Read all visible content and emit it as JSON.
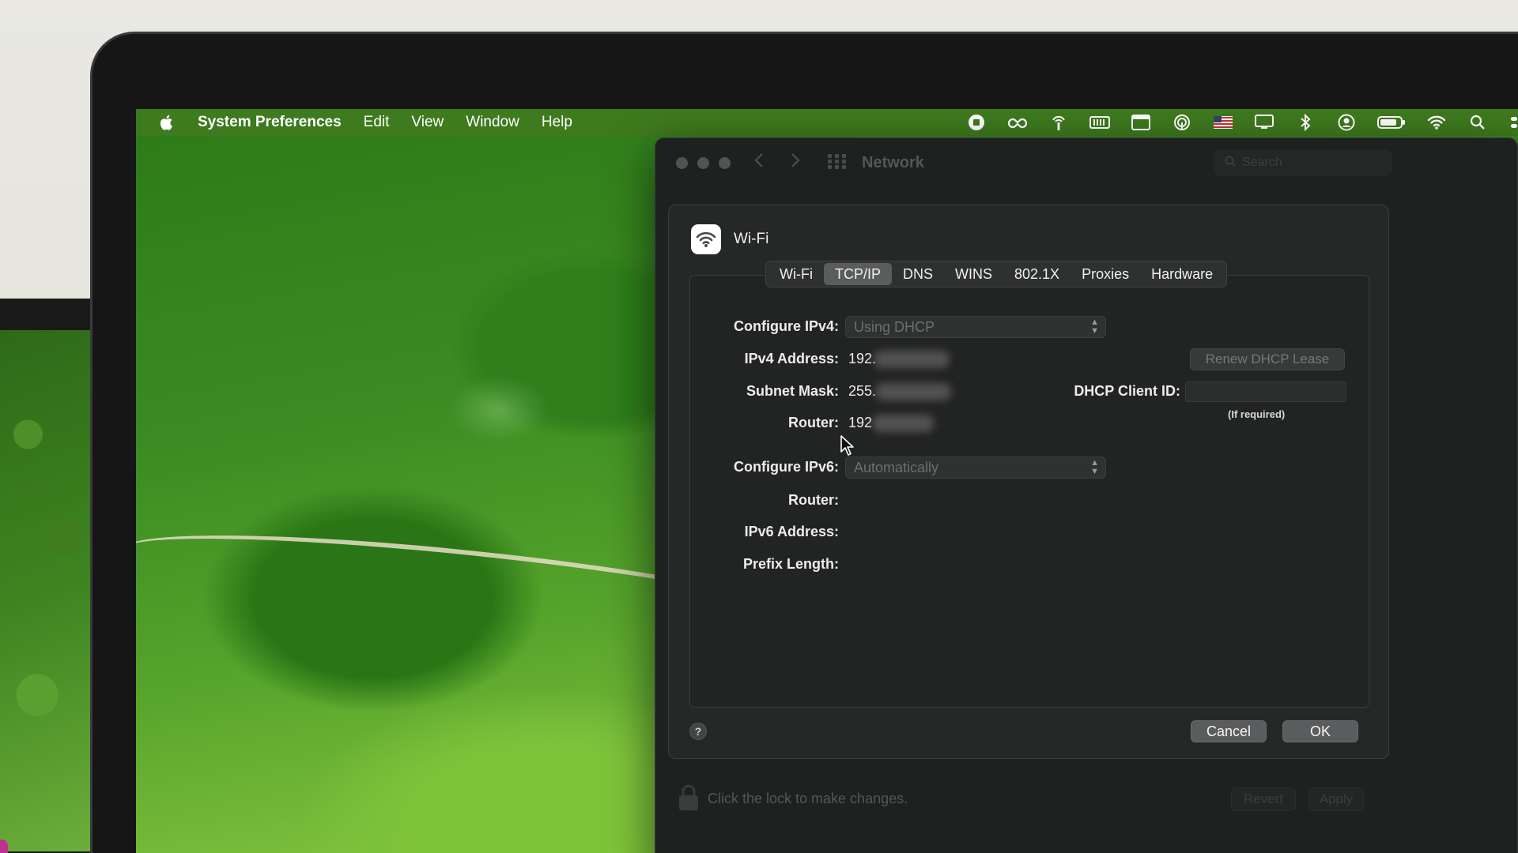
{
  "menubar": {
    "app_name": "System Preferences",
    "menus": [
      "Edit",
      "View",
      "Window",
      "Help"
    ],
    "status_icons": [
      "screen-record-icon",
      "creative-cloud-icon",
      "airdrop-icon",
      "memory-icon",
      "window-icon",
      "hotspot-icon",
      "flag-us-icon",
      "display-icon",
      "bluetooth-icon",
      "user-icon",
      "battery-icon",
      "wifi-icon",
      "spotlight-search-icon"
    ]
  },
  "window": {
    "title": "Network",
    "search_placeholder": "Search"
  },
  "sheet": {
    "interface_name": "Wi-Fi",
    "tabs": [
      "Wi-Fi",
      "TCP/IP",
      "DNS",
      "WINS",
      "802.1X",
      "Proxies",
      "Hardware"
    ],
    "selected_tab": "TCP/IP",
    "labels": {
      "configure_ipv4": "Configure IPv4:",
      "ipv4_address": "IPv4 Address:",
      "subnet_mask": "Subnet Mask:",
      "router_v4": "Router:",
      "configure_ipv6": "Configure IPv6:",
      "router_v6": "Router:",
      "ipv6_address": "IPv6 Address:",
      "prefix_length": "Prefix Length:",
      "dhcp_client_id": "DHCP Client ID:"
    },
    "values": {
      "configure_ipv4": "Using DHCP",
      "ipv4_address_visible": "192.",
      "subnet_mask_visible": "255.",
      "router_visible": "192",
      "configure_ipv6": "Automatically"
    },
    "renew_button": "Renew DHCP Lease",
    "if_required": "(If required)",
    "help": "?",
    "cancel": "Cancel",
    "ok": "OK"
  },
  "footer": {
    "lock_text": "Click the lock to make changes.",
    "revert": "Revert",
    "apply": "Apply"
  },
  "colors": {
    "menubar": "#3e7a1e",
    "window_bg": "#1f2020",
    "sheet_bg": "#262727",
    "selected_tab": "#5b5c5d"
  }
}
